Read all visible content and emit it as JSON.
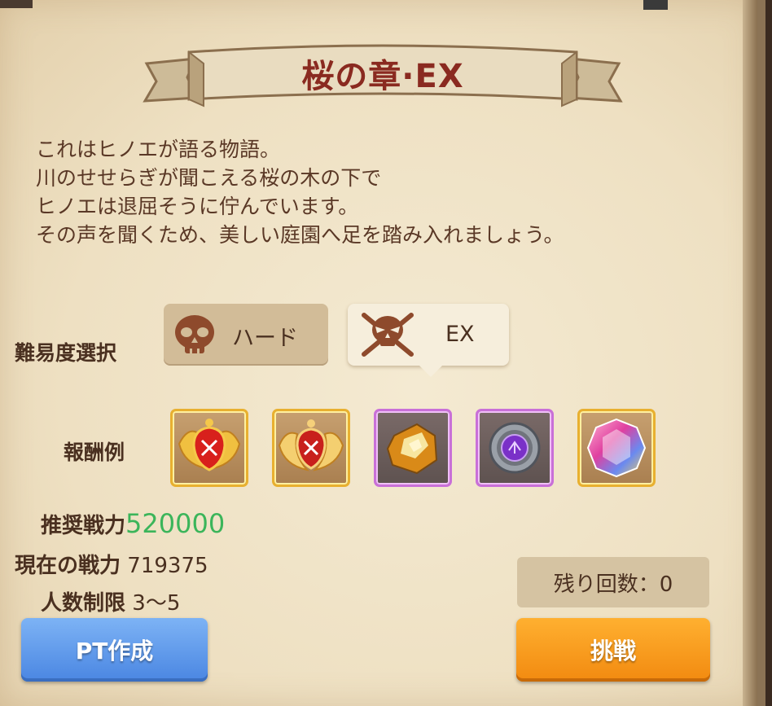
{
  "title": "桜の章·EX",
  "story": [
    "これはヒノエが語る物語。",
    "川のせせらぎが聞こえる桜の木の下で",
    "ヒノエは退屈そうに佇んでいます。",
    "その声を聞くため、美しい庭園へ足を踏み入れましょう。"
  ],
  "difficulty": {
    "label": "難易度選択",
    "options": [
      {
        "label": "ハード",
        "icon": "skull-icon",
        "selected": false
      },
      {
        "label": "EX",
        "icon": "crossed-swords-skull-icon",
        "selected": true
      }
    ]
  },
  "rewards": {
    "label": "報酬例",
    "items": [
      {
        "icon": "red-winged-emblem-icon",
        "frame": "gold"
      },
      {
        "icon": "red-winged-emblem-icon",
        "frame": "gold"
      },
      {
        "icon": "gold-ore-icon",
        "frame": "purple"
      },
      {
        "icon": "purple-gem-ring-icon",
        "frame": "purple"
      },
      {
        "icon": "rainbow-diamond-icon",
        "frame": "gold"
      }
    ]
  },
  "stats": {
    "recommended_label": "推奨戦力",
    "recommended_value": "520000",
    "current_label": "現在の戦力",
    "current_value": "719375",
    "party_label": "人数制限",
    "party_value": "3〜5"
  },
  "remaining": "残り回数：0",
  "buttons": {
    "create_party": "PT作成",
    "challenge": "挑戦"
  },
  "colors": {
    "recommended": "#3bb55a",
    "challenge": "#f28a10",
    "create_party": "#4a86e2"
  }
}
